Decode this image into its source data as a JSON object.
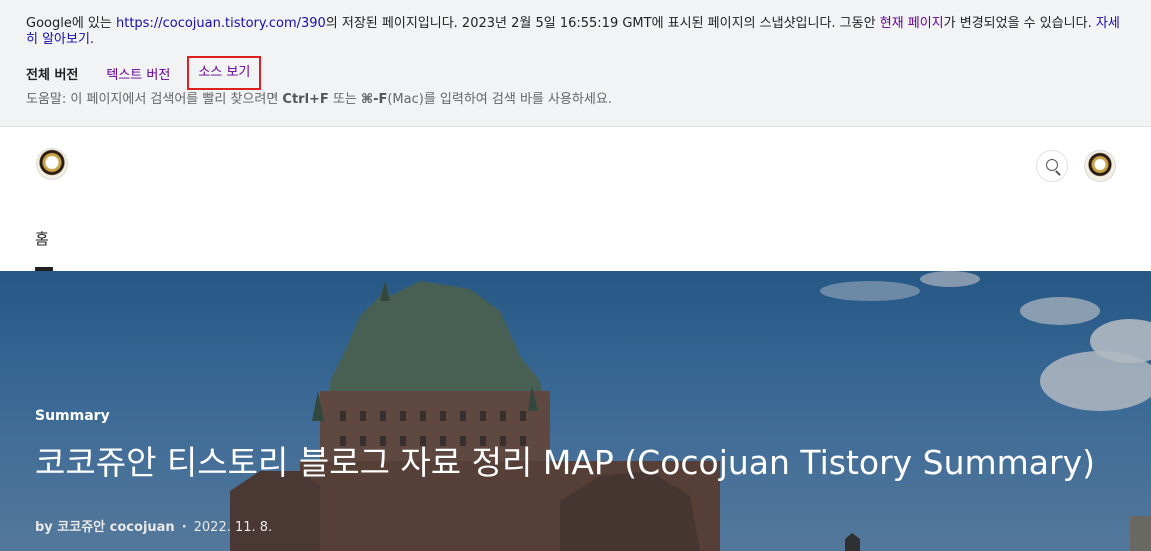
{
  "cache_banner": {
    "prefix": "Google에 있는 ",
    "url": "https://cocojuan.tistory.com/390",
    "middle": "의 저장된 페이지입니다. 2023년 2월 5일 16:55:19 GMT에 표시된 페이지의 스냅샷입니다. 그동안 ",
    "current_page_link": "현재 페이지",
    "suffix": "가 변경되었을 수 있습니다. ",
    "learn_more_link": "자세히 알아보기.",
    "versions": {
      "full": "전체 버전",
      "text": "텍스트 버전",
      "source": "소스 보기"
    },
    "help": {
      "before": "도움말: 이 페이지에서 검색어를 빨리 찾으려면 ",
      "shortcut1": "Ctrl+F",
      "or": " 또는 ",
      "shortcut2": "⌘-F",
      "after": "(Mac)를 입력하여 검색 바를 사용하세요."
    }
  },
  "blog_header": {
    "logo": "cocojuan-logo",
    "search_icon": "search-icon",
    "avatar": "profile-avatar",
    "nav": {
      "home": "홈"
    }
  },
  "hero": {
    "category": "Summary",
    "title": "코코쥬안 티스토리 블로그 자료 정리 MAP (Cocojuan Tistory Summary)",
    "author": "by 코코쥬안 cocojuan",
    "separator": "·",
    "date": "2022. 11. 8."
  },
  "colors": {
    "banner_bg": "#f1f3f4",
    "link_visited": "#660099",
    "link": "#1a0dab",
    "highlight_box": "#e02020",
    "sky": "#4a86bb"
  }
}
